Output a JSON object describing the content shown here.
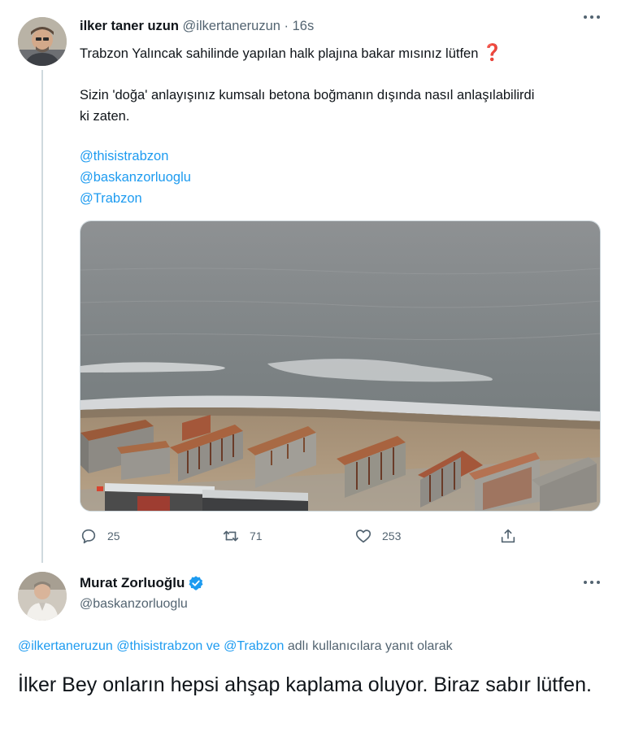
{
  "tweet1": {
    "name": "ilker taner uzun",
    "handle": "@ilkertaneruzun",
    "dot": "·",
    "time": "16s",
    "line1": "Trabzon Yalıncak sahilinde   yapılan halk plajına bakar mısınız lütfen",
    "line1_emoji": "❓",
    "line2": "Sizin 'doğa' anlayışınız kumsalı betona boğmanın dışında nasıl anlaşılabilirdi",
    "line3": "ki zaten.",
    "mentions": [
      "@thisistrabzon",
      "@baskanzorluoglu",
      "@Trabzon"
    ],
    "replies": "25",
    "retweets": "71",
    "likes": "253",
    "more_icon": "more-horizontal-icon"
  },
  "tweet2": {
    "name": "Murat Zorluoğlu",
    "handle": "@baskanzorluoglu",
    "verified_icon": "verified-badge-icon",
    "reply_mention_1": "@ilkertaneruzun",
    "reply_mention_2": "@thisistrabzon",
    "reply_connector": "ve",
    "reply_mention_3": "@Trabzon",
    "reply_suffix": "adlı kullanıcılara yanıt olarak",
    "body": "İlker Bey onların hepsi ahşap kaplama oluyor. Biraz sabır lütfen."
  },
  "colors": {
    "link": "#1d9bf0",
    "secondary_text": "#536471",
    "primary_text": "#0f1419",
    "verified": "#1d9bf0"
  }
}
